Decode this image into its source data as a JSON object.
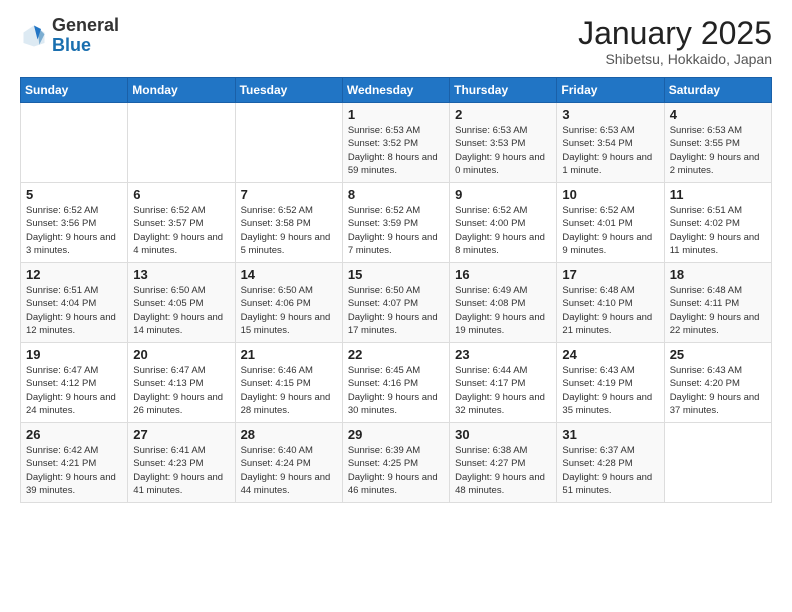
{
  "header": {
    "logo_general": "General",
    "logo_blue": "Blue",
    "month_title": "January 2025",
    "subtitle": "Shibetsu, Hokkaido, Japan"
  },
  "weekdays": [
    "Sunday",
    "Monday",
    "Tuesday",
    "Wednesday",
    "Thursday",
    "Friday",
    "Saturday"
  ],
  "weeks": [
    [
      {
        "day": "",
        "info": ""
      },
      {
        "day": "",
        "info": ""
      },
      {
        "day": "",
        "info": ""
      },
      {
        "day": "1",
        "info": "Sunrise: 6:53 AM\nSunset: 3:52 PM\nDaylight: 8 hours and 59 minutes."
      },
      {
        "day": "2",
        "info": "Sunrise: 6:53 AM\nSunset: 3:53 PM\nDaylight: 9 hours and 0 minutes."
      },
      {
        "day": "3",
        "info": "Sunrise: 6:53 AM\nSunset: 3:54 PM\nDaylight: 9 hours and 1 minute."
      },
      {
        "day": "4",
        "info": "Sunrise: 6:53 AM\nSunset: 3:55 PM\nDaylight: 9 hours and 2 minutes."
      }
    ],
    [
      {
        "day": "5",
        "info": "Sunrise: 6:52 AM\nSunset: 3:56 PM\nDaylight: 9 hours and 3 minutes."
      },
      {
        "day": "6",
        "info": "Sunrise: 6:52 AM\nSunset: 3:57 PM\nDaylight: 9 hours and 4 minutes."
      },
      {
        "day": "7",
        "info": "Sunrise: 6:52 AM\nSunset: 3:58 PM\nDaylight: 9 hours and 5 minutes."
      },
      {
        "day": "8",
        "info": "Sunrise: 6:52 AM\nSunset: 3:59 PM\nDaylight: 9 hours and 7 minutes."
      },
      {
        "day": "9",
        "info": "Sunrise: 6:52 AM\nSunset: 4:00 PM\nDaylight: 9 hours and 8 minutes."
      },
      {
        "day": "10",
        "info": "Sunrise: 6:52 AM\nSunset: 4:01 PM\nDaylight: 9 hours and 9 minutes."
      },
      {
        "day": "11",
        "info": "Sunrise: 6:51 AM\nSunset: 4:02 PM\nDaylight: 9 hours and 11 minutes."
      }
    ],
    [
      {
        "day": "12",
        "info": "Sunrise: 6:51 AM\nSunset: 4:04 PM\nDaylight: 9 hours and 12 minutes."
      },
      {
        "day": "13",
        "info": "Sunrise: 6:50 AM\nSunset: 4:05 PM\nDaylight: 9 hours and 14 minutes."
      },
      {
        "day": "14",
        "info": "Sunrise: 6:50 AM\nSunset: 4:06 PM\nDaylight: 9 hours and 15 minutes."
      },
      {
        "day": "15",
        "info": "Sunrise: 6:50 AM\nSunset: 4:07 PM\nDaylight: 9 hours and 17 minutes."
      },
      {
        "day": "16",
        "info": "Sunrise: 6:49 AM\nSunset: 4:08 PM\nDaylight: 9 hours and 19 minutes."
      },
      {
        "day": "17",
        "info": "Sunrise: 6:48 AM\nSunset: 4:10 PM\nDaylight: 9 hours and 21 minutes."
      },
      {
        "day": "18",
        "info": "Sunrise: 6:48 AM\nSunset: 4:11 PM\nDaylight: 9 hours and 22 minutes."
      }
    ],
    [
      {
        "day": "19",
        "info": "Sunrise: 6:47 AM\nSunset: 4:12 PM\nDaylight: 9 hours and 24 minutes."
      },
      {
        "day": "20",
        "info": "Sunrise: 6:47 AM\nSunset: 4:13 PM\nDaylight: 9 hours and 26 minutes."
      },
      {
        "day": "21",
        "info": "Sunrise: 6:46 AM\nSunset: 4:15 PM\nDaylight: 9 hours and 28 minutes."
      },
      {
        "day": "22",
        "info": "Sunrise: 6:45 AM\nSunset: 4:16 PM\nDaylight: 9 hours and 30 minutes."
      },
      {
        "day": "23",
        "info": "Sunrise: 6:44 AM\nSunset: 4:17 PM\nDaylight: 9 hours and 32 minutes."
      },
      {
        "day": "24",
        "info": "Sunrise: 6:43 AM\nSunset: 4:19 PM\nDaylight: 9 hours and 35 minutes."
      },
      {
        "day": "25",
        "info": "Sunrise: 6:43 AM\nSunset: 4:20 PM\nDaylight: 9 hours and 37 minutes."
      }
    ],
    [
      {
        "day": "26",
        "info": "Sunrise: 6:42 AM\nSunset: 4:21 PM\nDaylight: 9 hours and 39 minutes."
      },
      {
        "day": "27",
        "info": "Sunrise: 6:41 AM\nSunset: 4:23 PM\nDaylight: 9 hours and 41 minutes."
      },
      {
        "day": "28",
        "info": "Sunrise: 6:40 AM\nSunset: 4:24 PM\nDaylight: 9 hours and 44 minutes."
      },
      {
        "day": "29",
        "info": "Sunrise: 6:39 AM\nSunset: 4:25 PM\nDaylight: 9 hours and 46 minutes."
      },
      {
        "day": "30",
        "info": "Sunrise: 6:38 AM\nSunset: 4:27 PM\nDaylight: 9 hours and 48 minutes."
      },
      {
        "day": "31",
        "info": "Sunrise: 6:37 AM\nSunset: 4:28 PM\nDaylight: 9 hours and 51 minutes."
      },
      {
        "day": "",
        "info": ""
      }
    ]
  ]
}
